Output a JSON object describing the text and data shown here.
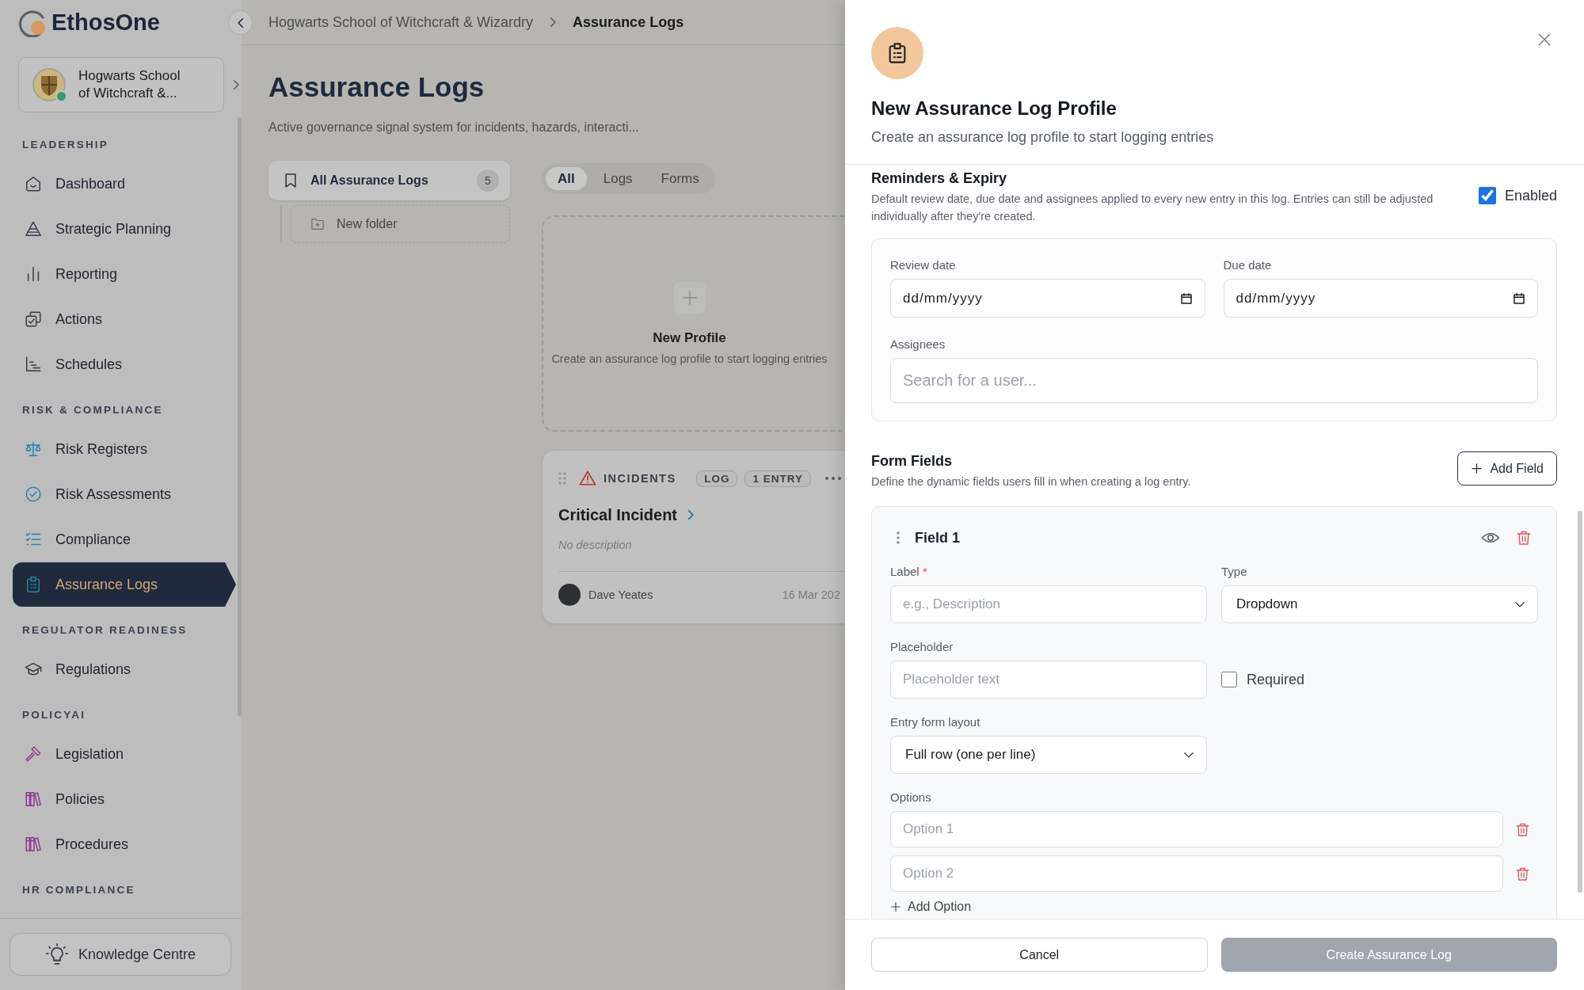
{
  "sidebar": {
    "logo": "EthosOne",
    "org": {
      "name": "Hogwarts School of Witchcraft &...",
      "online": true
    },
    "sections": [
      {
        "title": "LEADERSHIP",
        "items": [
          {
            "label": "Dashboard",
            "selected": false
          },
          {
            "label": "Strategic Planning",
            "selected": false
          },
          {
            "label": "Reporting",
            "selected": false
          },
          {
            "label": "Actions",
            "selected": false
          },
          {
            "label": "Schedules",
            "selected": false
          }
        ]
      },
      {
        "title": "RISK & COMPLIANCE",
        "items": [
          {
            "label": "Risk Registers",
            "selected": false
          },
          {
            "label": "Risk Assessments",
            "selected": false
          },
          {
            "label": "Compliance",
            "selected": false
          },
          {
            "label": "Assurance Logs",
            "selected": true
          }
        ]
      },
      {
        "title": "REGULATOR READINESS",
        "items": [
          {
            "label": "Regulations",
            "selected": false
          }
        ]
      },
      {
        "title": "POLICYAI",
        "items": [
          {
            "label": "Legislation",
            "selected": false
          },
          {
            "label": "Policies",
            "selected": false
          },
          {
            "label": "Procedures",
            "selected": false
          }
        ]
      },
      {
        "title": "HR COMPLIANCE"
      }
    ],
    "footer_button": "Knowledge Centre"
  },
  "breadcrumb": [
    {
      "label": "Hogwarts School of Witchcraft & Wizardry",
      "current": false
    },
    {
      "label": "Assurance Logs",
      "current": true
    }
  ],
  "page": {
    "title": "Assurance Logs",
    "subtitle": "Active governance signal system for incidents, hazards, interacti..."
  },
  "folders": {
    "all": {
      "label": "All Assurance Logs",
      "count": "5",
      "selected": true
    },
    "new_folder": "New folder"
  },
  "filter_tabs": [
    {
      "label": "All",
      "selected": true
    },
    {
      "label": "Logs",
      "selected": false
    },
    {
      "label": "Forms",
      "selected": false
    }
  ],
  "new_profile": {
    "title": "New Profile",
    "description": "Create an assurance log profile to start logging entries"
  },
  "log_cards": [
    {
      "category": "INCIDENTS",
      "badges": [
        "LOG",
        "1 ENTRY"
      ],
      "title": "Critical Incident",
      "description": "No description",
      "author": "Dave Yeates",
      "date": "16 Mar 202"
    }
  ],
  "panel": {
    "title": "New Assurance Log Profile",
    "subtitle": "Create an assurance log profile to start logging entries",
    "reminders": {
      "title": "Reminders & Expiry",
      "description": "Default review date, due date and assignees applied to every new entry in this log. Entries can still be adjusted individually after they're created.",
      "enabled": {
        "label": "Enabled",
        "checked": true
      },
      "dates": [
        {
          "label": "Review date",
          "value": "dd/mm/yyyy"
        },
        {
          "label": "Due date",
          "value": "dd/mm/yyyy"
        }
      ],
      "assignees": {
        "label": "Assignees",
        "placeholder": "Search for a user..."
      }
    },
    "form_fields": {
      "title": "Form Fields",
      "description": "Define the dynamic fields users fill in when creating a log entry.",
      "add_button": "Add Field",
      "fields": [
        {
          "title": "Field 1",
          "label": {
            "label": "Label",
            "required_mark": "*",
            "placeholder": "e.g., Description"
          },
          "type": {
            "label": "Type",
            "value": "Dropdown"
          },
          "placeholder": {
            "label": "Placeholder",
            "placeholder": "Placeholder text"
          },
          "required": {
            "label": "Required",
            "checked": false
          },
          "layout": {
            "label": "Entry form layout",
            "value": "Full row (one per line)"
          },
          "options_label": "Options",
          "options": [
            {
              "placeholder": "Option 1"
            },
            {
              "placeholder": "Option 2"
            }
          ],
          "add_option": "Add Option"
        }
      ]
    },
    "footer": {
      "cancel": "Cancel",
      "create": {
        "label": "Create Assurance Log",
        "disabled": true
      }
    }
  }
}
